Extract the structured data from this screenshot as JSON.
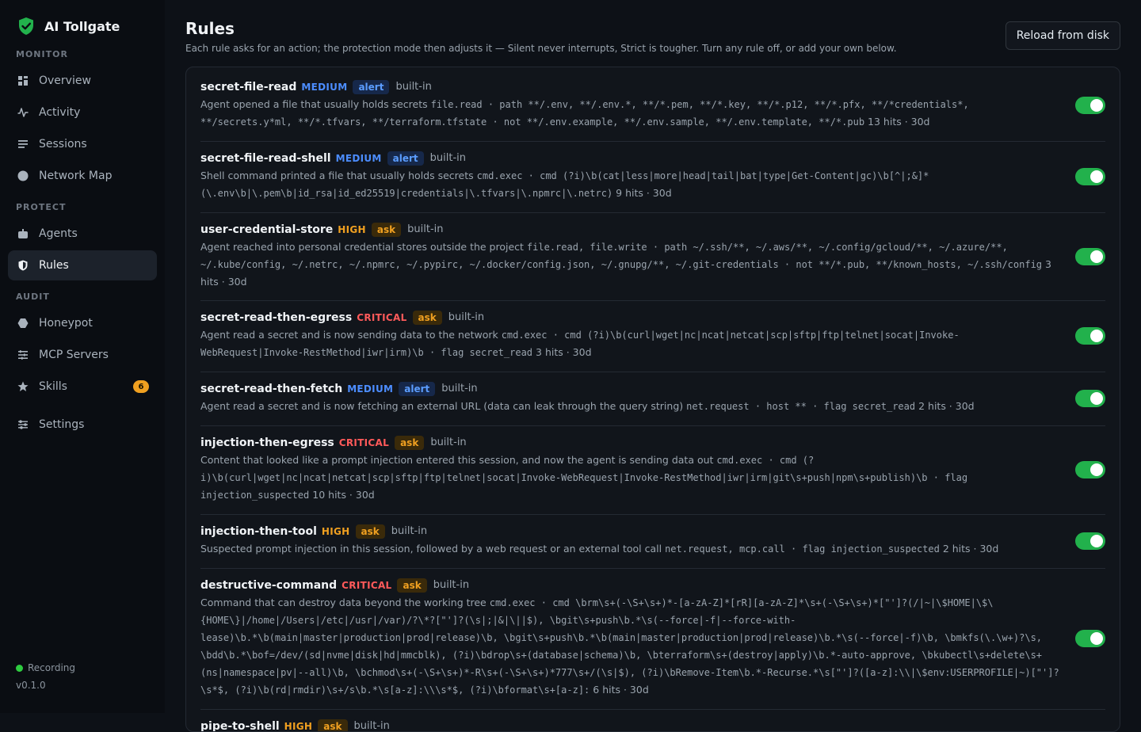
{
  "app": {
    "name": "AI Tollgate"
  },
  "sidebar": {
    "sections": [
      {
        "label": "MONITOR",
        "items": [
          {
            "label": "Overview",
            "icon": "grid-icon"
          },
          {
            "label": "Activity",
            "icon": "pulse-icon"
          },
          {
            "label": "Sessions",
            "icon": "list-icon"
          },
          {
            "label": "Network Map",
            "icon": "globe-icon"
          }
        ]
      },
      {
        "label": "PROTECT",
        "items": [
          {
            "label": "Agents",
            "icon": "robot-icon"
          },
          {
            "label": "Rules",
            "icon": "shield-icon",
            "active": true
          }
        ]
      },
      {
        "label": "AUDIT",
        "items": [
          {
            "label": "Honeypot",
            "icon": "honeypot-icon"
          },
          {
            "label": "MCP Servers",
            "icon": "servers-icon"
          },
          {
            "label": "Skills",
            "icon": "star-icon",
            "badge": "6"
          }
        ]
      }
    ],
    "settings_label": "Settings",
    "footer": {
      "status": "Recording",
      "version": "v0.1.0"
    }
  },
  "header": {
    "title": "Rules",
    "subtitle": "Each rule asks for an action; the protection mode then adjusts it — Silent never interrupts, Strict is tougher. Turn any rule off, or add your own below.",
    "reload_label": "Reload from disk"
  },
  "colors": {
    "medium": "#4c8dff",
    "high": "#f0a020",
    "critical": "#ff5a5a",
    "toggle_on": "#22b14c"
  },
  "rules": [
    {
      "name": "secret-file-read",
      "severity": "MEDIUM",
      "action": "alert",
      "origin": "built-in",
      "description": "Agent opened a file that usually holds secrets",
      "match": "file.read · path **/.env, **/.env.*, **/*.pem, **/*.key, **/*.p12, **/*.pfx, **/*credentials*, **/secrets.y*ml, **/*.tfvars, **/terraform.tfstate · not **/.env.example, **/.env.sample, **/.env.template, **/*.pub",
      "stats": "13 hits · 30d",
      "enabled": true
    },
    {
      "name": "secret-file-read-shell",
      "severity": "MEDIUM",
      "action": "alert",
      "origin": "built-in",
      "description": "Shell command printed a file that usually holds secrets",
      "match": "cmd.exec · cmd (?i)\\b(cat|less|more|head|tail|bat|type|Get-Content|gc)\\b[^|;&]*(\\.env\\b|\\.pem\\b|id_rsa|id_ed25519|credentials|\\.tfvars|\\.npmrc|\\.netrc)",
      "stats": "9 hits · 30d",
      "enabled": true
    },
    {
      "name": "user-credential-store",
      "severity": "HIGH",
      "action": "ask",
      "origin": "built-in",
      "description": "Agent reached into personal credential stores outside the project",
      "match": "file.read, file.write · path ~/.ssh/**, ~/.aws/**, ~/.config/gcloud/**, ~/.azure/**, ~/.kube/config, ~/.netrc, ~/.npmrc, ~/.pypirc, ~/.docker/config.json, ~/.gnupg/**, ~/.git-credentials · not **/*.pub, **/known_hosts, ~/.ssh/config",
      "stats": "3 hits · 30d",
      "enabled": true
    },
    {
      "name": "secret-read-then-egress",
      "severity": "CRITICAL",
      "action": "ask",
      "origin": "built-in",
      "description": "Agent read a secret and is now sending data to the network",
      "match": "cmd.exec · cmd (?i)\\b(curl|wget|nc|ncat|netcat|scp|sftp|ftp|telnet|socat|Invoke-WebRequest|Invoke-RestMethod|iwr|irm)\\b · flag secret_read",
      "stats": "3 hits · 30d",
      "enabled": true
    },
    {
      "name": "secret-read-then-fetch",
      "severity": "MEDIUM",
      "action": "alert",
      "origin": "built-in",
      "description": "Agent read a secret and is now fetching an external URL (data can leak through the query string)",
      "match": "net.request · host ** · flag secret_read",
      "stats": "2 hits · 30d",
      "enabled": true
    },
    {
      "name": "injection-then-egress",
      "severity": "CRITICAL",
      "action": "ask",
      "origin": "built-in",
      "description": "Content that looked like a prompt injection entered this session, and now the agent is sending data out",
      "match": "cmd.exec · cmd (?i)\\b(curl|wget|nc|ncat|netcat|scp|sftp|ftp|telnet|socat|Invoke-WebRequest|Invoke-RestMethod|iwr|irm|git\\s+push|npm\\s+publish)\\b · flag injection_suspected",
      "stats": "10 hits · 30d",
      "enabled": true
    },
    {
      "name": "injection-then-tool",
      "severity": "HIGH",
      "action": "ask",
      "origin": "built-in",
      "description": "Suspected prompt injection in this session, followed by a web request or an external tool call",
      "match": "net.request, mcp.call · flag injection_suspected",
      "stats": "2 hits · 30d",
      "enabled": true
    },
    {
      "name": "destructive-command",
      "severity": "CRITICAL",
      "action": "ask",
      "origin": "built-in",
      "description": "Command that can destroy data beyond the working tree",
      "match": "cmd.exec · cmd \\brm\\s+(-\\S+\\s+)*-[a-zA-Z]*[rR][a-zA-Z]*\\s+(-\\S+\\s+)*[\"']?(/|~|\\$HOME|\\$\\{HOME\\}|/home|/Users|/etc|/usr|/var)/?\\*?[\"']?(\\s|;|&|\\||$), \\bgit\\s+push\\b.*\\s(--force|-f|--force-with-lease)\\b.*\\b(main|master|production|prod|release)\\b, \\bgit\\s+push\\b.*\\b(main|master|production|prod|release)\\b.*\\s(--force|-f)\\b, \\bmkfs(\\.\\w+)?\\s, \\bdd\\b.*\\bof=/dev/(sd|nvme|disk|hd|mmcblk), (?i)\\bdrop\\s+(database|schema)\\b, \\bterraform\\s+(destroy|apply)\\b.*-auto-approve, \\bkubectl\\s+delete\\s+(ns|namespace|pv|--all)\\b, \\bchmod\\s+(-\\S+\\s+)*-R\\s+(-\\S+\\s+)*777\\s+/(\\s|$), (?i)\\bRemove-Item\\b.*-Recurse.*\\s[\"']?([a-z]:\\\\|\\$env:USERPROFILE|~)[\"']?\\s*$, (?i)\\b(rd|rmdir)\\s+/s\\b.*\\s[a-z]:\\\\\\s*$, (?i)\\bformat\\s+[a-z]:",
      "stats": "6 hits · 30d",
      "enabled": true
    },
    {
      "name": "pipe-to-shell",
      "severity": "HIGH",
      "action": "ask",
      "origin": "built-in",
      "description": "",
      "match": "",
      "stats": "",
      "enabled": true
    }
  ]
}
